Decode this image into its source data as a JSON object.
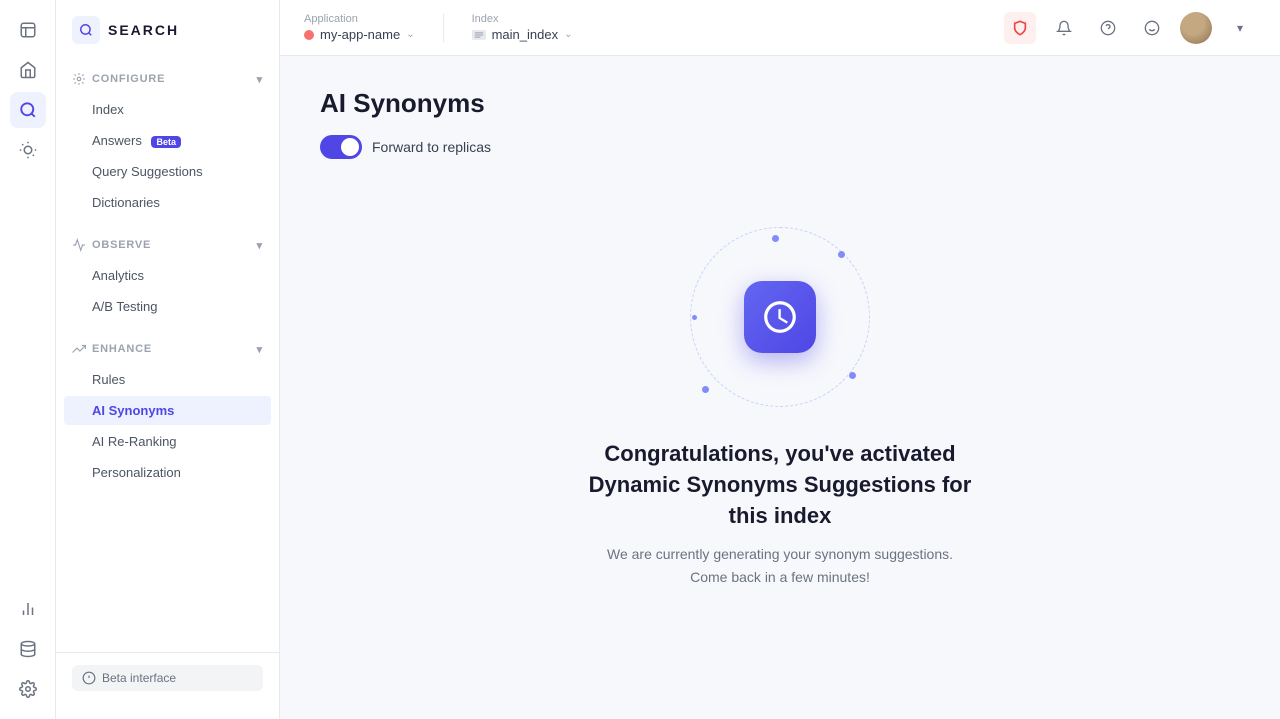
{
  "logo": {
    "icon": "⬡",
    "text": "SEARCH"
  },
  "topbar": {
    "application_label": "Application",
    "application_value": "my-app-name",
    "index_label": "Index",
    "index_value": "main_index"
  },
  "sidebar": {
    "configure_label": "CONFIGURE",
    "items_configure": [
      {
        "id": "index",
        "label": "Index",
        "active": false
      },
      {
        "id": "answers",
        "label": "Answers",
        "badge": "Beta",
        "active": false
      },
      {
        "id": "query-suggestions",
        "label": "Query Suggestions",
        "active": false
      },
      {
        "id": "dictionaries",
        "label": "Dictionaries",
        "active": false
      }
    ],
    "observe_label": "OBSERVE",
    "items_observe": [
      {
        "id": "analytics",
        "label": "Analytics",
        "active": false
      },
      {
        "id": "ab-testing",
        "label": "A/B Testing",
        "active": false
      }
    ],
    "enhance_label": "ENHANCE",
    "items_enhance": [
      {
        "id": "rules",
        "label": "Rules",
        "active": false
      },
      {
        "id": "ai-synonyms",
        "label": "AI Synonyms",
        "active": true
      },
      {
        "id": "ai-re-ranking",
        "label": "AI Re-Ranking",
        "active": false
      },
      {
        "id": "personalization",
        "label": "Personalization",
        "active": false
      }
    ],
    "beta_interface": "Beta interface"
  },
  "page": {
    "title": "AI Synonyms",
    "toggle_label": "Forward to replicas",
    "congrats_title": "Congratulations, you've activated Dynamic Synonyms Suggestions for this index",
    "congrats_subtitle": "We are currently generating your synonym suggestions. Come back in a few minutes!"
  }
}
